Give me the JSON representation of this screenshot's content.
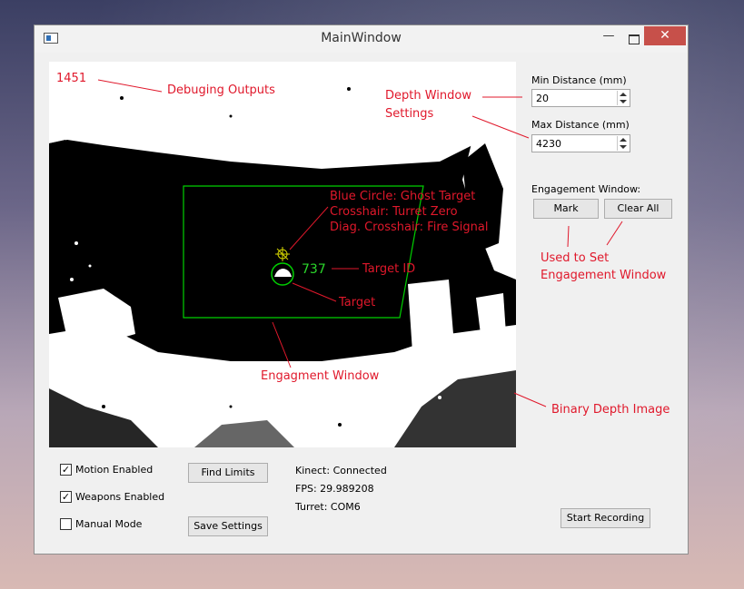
{
  "window": {
    "title": "MainWindow",
    "close_symbol": "✕",
    "minimize_symbol": "—"
  },
  "depth_view": {
    "debug_output": "1451",
    "target_id": "737",
    "colors": {
      "engagement_window": "#00d000",
      "target": "#00d000",
      "crosshair": "#d6d600",
      "text": "#2bd62b"
    }
  },
  "settings": {
    "min_distance_label": "Min Distance (mm)",
    "min_distance_value": "20",
    "max_distance_label": "Max Distance (mm)",
    "max_distance_value": "4230",
    "engagement_label": "Engagement Window:",
    "mark_label": "Mark",
    "clear_all_label": "Clear All"
  },
  "controls": {
    "motion_enabled_label": "Motion Enabled",
    "motion_enabled_checked": true,
    "weapons_enabled_label": "Weapons Enabled",
    "weapons_enabled_checked": true,
    "manual_mode_label": "Manual Mode",
    "manual_mode_checked": false,
    "find_limits_label": "Find Limits",
    "save_settings_label": "Save Settings",
    "start_recording_label": "Start Recording"
  },
  "status": {
    "kinect": "Kinect: Connected",
    "fps": "FPS: 29.989208",
    "turret": "Turret: COM6"
  },
  "annotations": {
    "color": "#e0182b",
    "debug": "Debuging Outputs",
    "depth_window_1": "Depth Window",
    "depth_window_2": "Settings",
    "blue_circle": "Blue Circle: Ghost Target",
    "crosshair": "Crosshair: Turret Zero",
    "diag_crosshair": "Diag. Crosshair: Fire Signal",
    "target_id": "Target ID",
    "target": "Target",
    "used_to_set_1": "Used to Set",
    "used_to_set_2": "Engagement Window",
    "engagement_window": "Engagment Window",
    "binary_depth": "Binary Depth Image"
  }
}
